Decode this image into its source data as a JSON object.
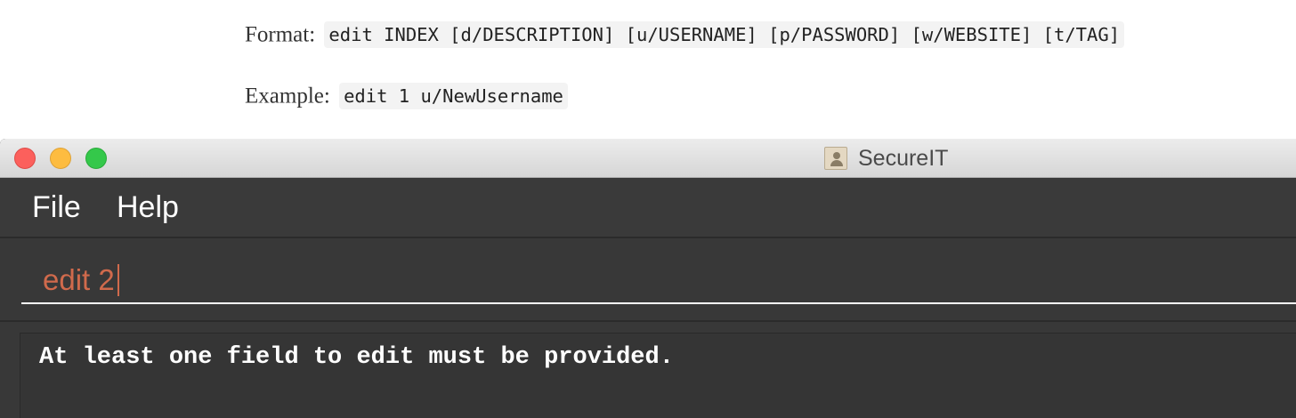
{
  "doc": {
    "format_label": "Format:",
    "format_code": "edit INDEX [d/DESCRIPTION] [u/USERNAME] [p/PASSWORD] [w/WEBSITE] [t/TAG]",
    "example_label": "Example:",
    "example_code": "edit 1 u/NewUsername"
  },
  "window": {
    "title": "SecureIT",
    "icon": "app-icon"
  },
  "menu": {
    "file_label": "File",
    "help_label": "Help"
  },
  "command": {
    "value": "edit 2",
    "text_color": "#d06a4c"
  },
  "result": {
    "message": "At least one field to edit must be provided."
  }
}
